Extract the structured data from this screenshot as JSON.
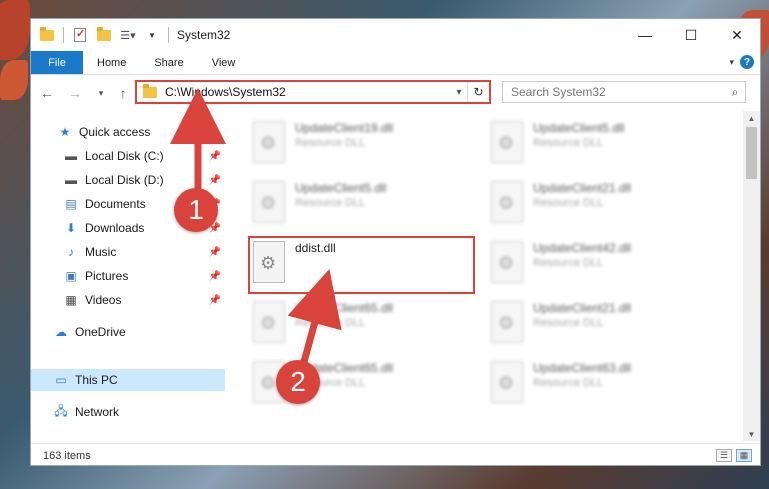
{
  "window": {
    "title": "System32"
  },
  "ribbon": {
    "tabs": [
      "File",
      "Home",
      "Share",
      "View"
    ],
    "help_label": "?"
  },
  "address": {
    "path": "C:\\Windows\\System32",
    "search_placeholder": "Search System32"
  },
  "nav_pane": {
    "items": [
      {
        "label": "Quick access",
        "icon": "star-icon",
        "pinned": false
      },
      {
        "label": "Local Disk (C:)",
        "icon": "drive-icon",
        "pinned": true
      },
      {
        "label": "Local Disk (D:)",
        "icon": "drive-icon",
        "pinned": true
      },
      {
        "label": "Documents",
        "icon": "documents-icon",
        "pinned": true
      },
      {
        "label": "Downloads",
        "icon": "downloads-icon",
        "pinned": true
      },
      {
        "label": "Music",
        "icon": "music-icon",
        "pinned": true
      },
      {
        "label": "Pictures",
        "icon": "pictures-icon",
        "pinned": true
      },
      {
        "label": "Videos",
        "icon": "videos-icon",
        "pinned": true
      },
      {
        "label": "OneDrive",
        "icon": "cloud-icon",
        "pinned": false
      },
      {
        "label": "This PC",
        "icon": "computer-icon",
        "pinned": false,
        "selected": true
      },
      {
        "label": "Network",
        "icon": "network-icon",
        "pinned": false
      }
    ]
  },
  "files": {
    "left": [
      {
        "name": "UpdateClient19.dll",
        "type": "Resource DLL"
      },
      {
        "name": "UpdateClient5.dll",
        "type": "Resource DLL"
      },
      {
        "name": "ddist.dll",
        "type": ""
      },
      {
        "name": "UpdateClient65.dll",
        "type": "Resource DLL"
      },
      {
        "name": "UpdateClient65.dll",
        "type": "Resource DLL"
      }
    ],
    "right": [
      {
        "name": "UpdateClient5.dll",
        "type": "Resource DLL"
      },
      {
        "name": "UpdateClient21.dll",
        "type": "Resource DLL"
      },
      {
        "name": "UpdateClient42.dll",
        "type": "Resource DLL"
      },
      {
        "name": "UpdateClient21.dll",
        "type": "Resource DLL"
      },
      {
        "name": "UpdateClient63.dll",
        "type": "Resource DLL"
      }
    ]
  },
  "status": {
    "items_count": "163 items"
  },
  "annotations": {
    "step1": "1",
    "step2": "2",
    "color": "#d9433b"
  }
}
